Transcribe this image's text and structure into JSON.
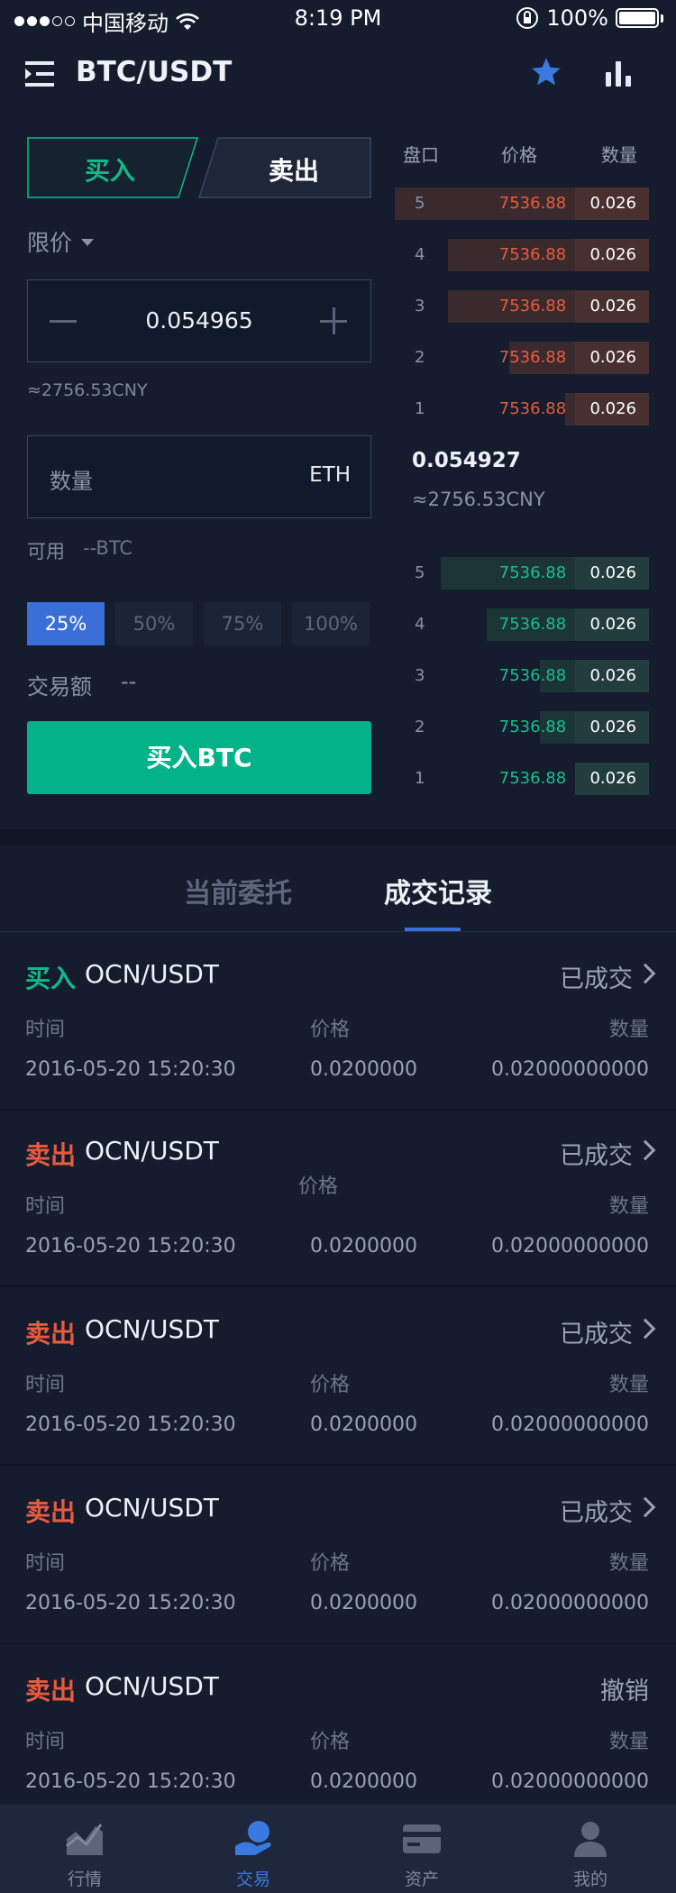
{
  "status_bar": {
    "carrier": "中国移动",
    "time": "8:19 PM",
    "battery": "100%"
  },
  "header": {
    "title": "BTC/USDT"
  },
  "trade_tabs": {
    "buy": "买入",
    "sell": "卖出"
  },
  "order_type": "限价",
  "price_input": {
    "value": "0.054965"
  },
  "price_cny": "≈2756.53CNY",
  "quantity_input": {
    "placeholder": "数量",
    "unit": "ETH"
  },
  "available": {
    "label": "可用",
    "value": "--BTC"
  },
  "percent_buttons": [
    "25%",
    "50%",
    "75%",
    "100%"
  ],
  "trade_amount": {
    "label": "交易额",
    "value": "--"
  },
  "buy_button": "买入BTC",
  "order_book": {
    "headers": {
      "level": "盘口",
      "price": "价格",
      "qty": "数量"
    },
    "asks": [
      {
        "level": "5",
        "price": "7536.88",
        "qty": "0.026",
        "depth": 1.0
      },
      {
        "level": "4",
        "price": "7536.88",
        "qty": "0.026",
        "depth": 0.79
      },
      {
        "level": "3",
        "price": "7536.88",
        "qty": "0.026",
        "depth": 0.79
      },
      {
        "level": "2",
        "price": "7536.88",
        "qty": "0.026",
        "depth": 0.55
      },
      {
        "level": "1",
        "price": "7536.88",
        "qty": "0.026",
        "depth": 0.33
      }
    ],
    "last_price": "0.054927",
    "last_cny": "≈2756.53CNY",
    "bids": [
      {
        "level": "5",
        "price": "7536.88",
        "qty": "0.026",
        "depth": 0.82
      },
      {
        "level": "4",
        "price": "7536.88",
        "qty": "0.026",
        "depth": 0.64
      },
      {
        "level": "3",
        "price": "7536.88",
        "qty": "0.026",
        "depth": 0.43
      },
      {
        "level": "2",
        "price": "7536.88",
        "qty": "0.026",
        "depth": 0.43
      },
      {
        "level": "1",
        "price": "7536.88",
        "qty": "0.026",
        "depth": 0.22
      }
    ]
  },
  "record_tabs": {
    "current": "当前委托",
    "history": "成交记录"
  },
  "trades": [
    {
      "side": "买入",
      "pair": "OCN/USDT",
      "status": "已成交",
      "time_label": "时间",
      "price_label": "价格",
      "qty_label": "数量",
      "time": "2016-05-20 15:20:30",
      "price": "0.0200000",
      "qty": "0.02000000000"
    },
    {
      "side": "卖出",
      "pair": "OCN/USDT",
      "status": "已成交",
      "time_label": "时间",
      "price_label": "价格",
      "qty_label": "数量",
      "time": "2016-05-20 15:20:30",
      "price": "0.0200000",
      "qty": "0.02000000000"
    },
    {
      "side": "卖出",
      "pair": "OCN/USDT",
      "status": "已成交",
      "time_label": "时间",
      "price_label": "价格",
      "qty_label": "数量",
      "time": "2016-05-20 15:20:30",
      "price": "0.0200000",
      "qty": "0.02000000000"
    },
    {
      "side": "卖出",
      "pair": "OCN/USDT",
      "status": "已成交",
      "time_label": "时间",
      "price_label": "价格",
      "qty_label": "数量",
      "time": "2016-05-20 15:20:30",
      "price": "0.0200000",
      "qty": "0.02000000000"
    },
    {
      "side": "卖出",
      "pair": "OCN/USDT",
      "status": "撤销",
      "time_label": "时间",
      "price_label": "价格",
      "qty_label": "数量",
      "time": "2016-05-20 15:20:30",
      "price": "0.0200000",
      "qty": "0.02000000000"
    }
  ],
  "bottom_nav": [
    {
      "label": "行情",
      "icon": "market-chart-icon"
    },
    {
      "label": "交易",
      "icon": "trade-hand-coin-icon",
      "active": true
    },
    {
      "label": "资产",
      "icon": "wallet-card-icon"
    },
    {
      "label": "我的",
      "icon": "profile-user-icon"
    }
  ],
  "colors": {
    "background": "#141c2e",
    "buy": "#11b98a",
    "sell": "#e85b3e",
    "accent": "#3a6fd8",
    "buy_button": "#04b289"
  }
}
